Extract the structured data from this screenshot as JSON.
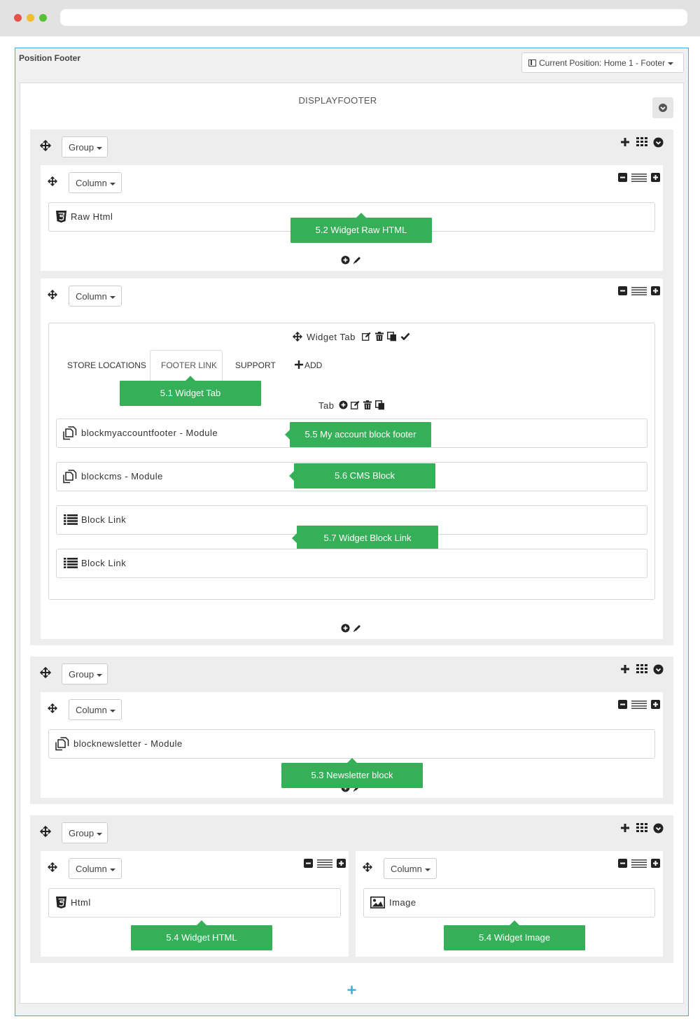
{
  "position": {
    "title": "Position Footer",
    "current_position_label": "Current Position: Home 1 - Footer"
  },
  "hook": {
    "name": "DISPLAYFOOTER"
  },
  "labels": {
    "group": "Group",
    "column": "Column"
  },
  "widgets": {
    "raw_html": "Raw Html",
    "widget_tab_title": "Widget Tab",
    "tab_label": "Tab",
    "myaccount": "blockmyaccountfooter - Module",
    "blockcms": "blockcms - Module",
    "block_link_1": "Block Link",
    "block_link_2": "Block Link",
    "newsletter": "blocknewsletter - Module",
    "html": "Html",
    "image": "Image"
  },
  "tabs": [
    "STORE LOCATIONS",
    "FOOTER LINK",
    "SUPPORT",
    "ADD"
  ],
  "callouts": {
    "raw_html": "5.2 Widget Raw HTML",
    "widget_tab": "5.1 Widget Tab",
    "myaccount": "5.5 My account block footer",
    "cms": "5.6 CMS Block",
    "block_link": "5.7 Widget Block Link",
    "newsletter": "5.3 Newsletter block",
    "html": "5.4 Widget HTML",
    "image": "5.4 Widget Image"
  },
  "colors": {
    "accent": "#3fb0d9",
    "callout_green": "#35b058",
    "traffic_red": "#e5534b",
    "traffic_yellow": "#f1bc2d",
    "traffic_green": "#57c038"
  }
}
